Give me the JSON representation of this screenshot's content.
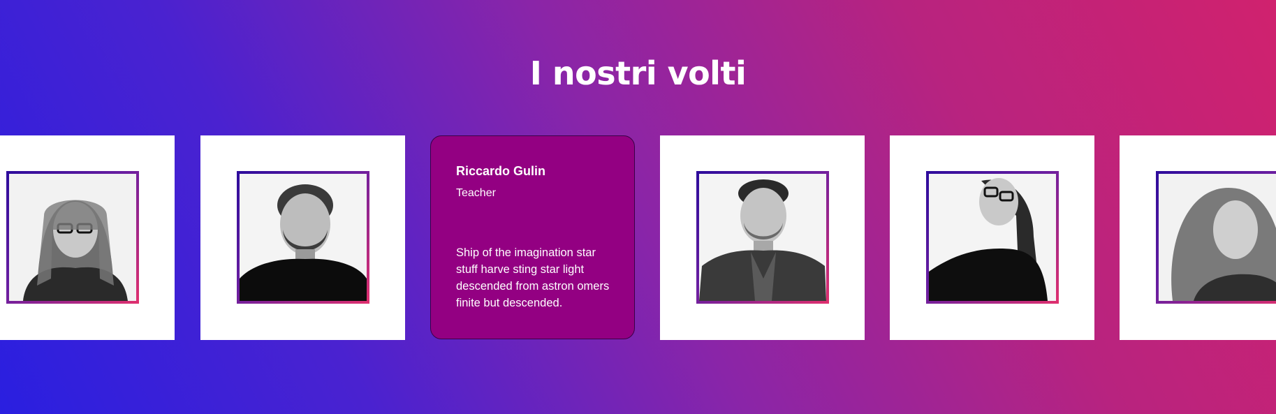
{
  "section": {
    "title": "I nostri volti"
  },
  "team": [
    {
      "id": "member-1",
      "photo_alt": "Portrait of a woman with glasses and long hair"
    },
    {
      "id": "member-2",
      "photo_alt": "Portrait of a bearded man in a black turtleneck"
    },
    {
      "id": "member-3",
      "name": "Riccardo Gulin",
      "role": "Teacher",
      "bio": "Ship of the imagination star stuff harve sting star light descended from astron omers finite but descended."
    },
    {
      "id": "member-4",
      "photo_alt": "Portrait of a man in a blazer"
    },
    {
      "id": "member-5",
      "photo_alt": "Portrait of a woman with glasses"
    },
    {
      "id": "member-6",
      "photo_alt": "Portrait of a smiling woman with long hair"
    }
  ],
  "colors": {
    "gradient_start": "#2a1fe0",
    "gradient_end": "#d0226e",
    "info_card": "#930082",
    "frame_start": "#2d0c9c",
    "frame_end": "#e0306e"
  }
}
